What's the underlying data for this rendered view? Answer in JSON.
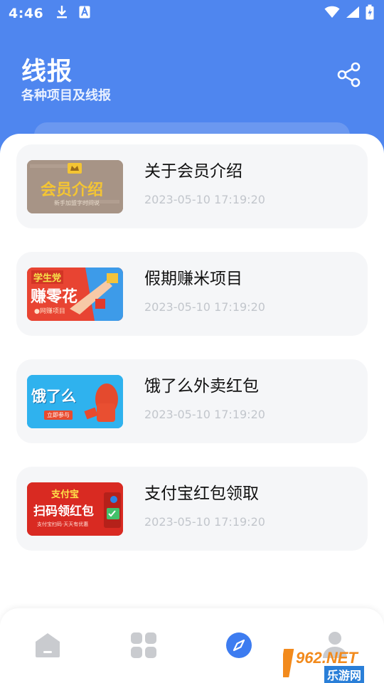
{
  "status_bar": {
    "time": "4:46",
    "icons": [
      "download-icon",
      "text-a-icon",
      "wifi-icon",
      "signal-icon",
      "battery-icon"
    ]
  },
  "header": {
    "title": "线报",
    "subtitle": "各种项目及线报",
    "share_icon": "share-icon"
  },
  "articles": [
    {
      "title": "关于会员介绍",
      "time": "2023-05-10 17:19:20",
      "thumb_text": "会员介绍",
      "thumb_subtext": "新手加盟字时间说"
    },
    {
      "title": "假期赚米项目",
      "time": "2023-05-10 17:19:20",
      "thumb_text": "赚零花",
      "thumb_tag": "学生党",
      "thumb_subtext": "●网赚项目"
    },
    {
      "title": "饿了么外卖红包",
      "time": "2023-05-10 17:19:20",
      "thumb_text": "饿了么",
      "thumb_subtext": "立即参与"
    },
    {
      "title": "支付宝红包领取",
      "time": "2023-05-10 17:19:20",
      "thumb_tag": "支付宝",
      "thumb_text": "扫码领红包",
      "thumb_subtext": "支付宝扫码·天天有优惠"
    }
  ],
  "bottom_nav": {
    "items": [
      "home-icon",
      "grid-icon",
      "compass-icon",
      "user-icon"
    ],
    "active_index": 2
  },
  "watermark": {
    "brand": "962.NET",
    "sub": "乐游网"
  },
  "colors": {
    "header_blue": "#4f86ef",
    "nav_active": "#3d7cf0",
    "nav_inactive": "#c9cbcf",
    "card_bg": "#f5f6f8"
  }
}
